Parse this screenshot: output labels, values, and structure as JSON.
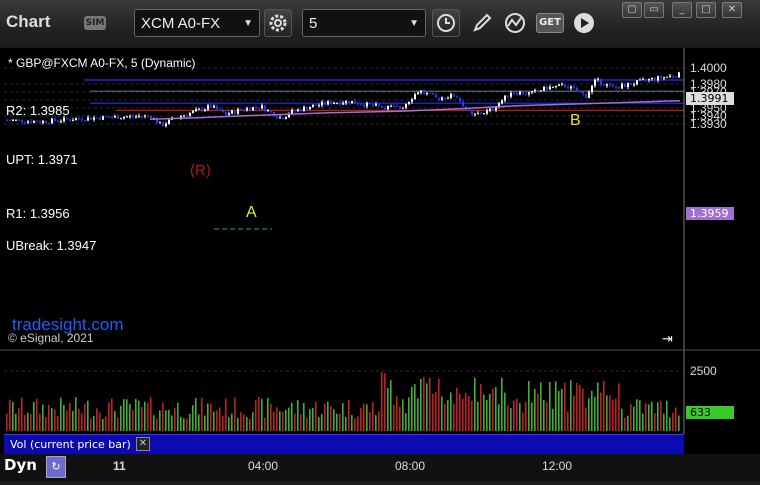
{
  "toolbar": {
    "title": "Chart",
    "sim_badge": "SIM",
    "symbol": "XCM A0-FX",
    "interval": "5",
    "get_label": "GET"
  },
  "chart": {
    "subtitle": "* GBP@FXCM A0-FX, 5 (Dynamic)",
    "copyright": "© eSignal, 2021",
    "watermark": "tradesight.com",
    "levels": [
      {
        "label": "R2: 1.3985",
        "price": 1.3985,
        "color": "#2a2aff"
      },
      {
        "label": "UPT: 1.3971",
        "price": 1.3971,
        "color": "#6a6a6a"
      },
      {
        "label": "R1: 1.3956",
        "price": 1.3956,
        "color": "#2a2aff"
      },
      {
        "label": "UBreak: 1.3947",
        "price": 1.3947,
        "color": "#c01818"
      }
    ],
    "markers": [
      {
        "text": "A",
        "color": "#e6e633"
      },
      {
        "text": "B",
        "color": "#e6e633"
      },
      {
        "text": "(R)",
        "color": "#b01818"
      }
    ],
    "price_axis": [
      "1.4000",
      "1.3980",
      "1.3970",
      "1.3960",
      "1.3950",
      "1.3940",
      "1.3930"
    ],
    "last_price": "1.3991",
    "ma_price": "1.3959",
    "volume_axis": [
      "2500"
    ],
    "last_volume": "633",
    "volume_label": "Vol (current price bar)",
    "time_labels": [
      "11",
      "04:00",
      "08:00",
      "12:00"
    ],
    "dynamic_label": "Dyn",
    "colors": {
      "up": "#ffffff",
      "down": "#1e3cff",
      "ma": "#a070d0",
      "vol_up": "#3fb02f",
      "vol_down": "#c02020"
    }
  }
}
